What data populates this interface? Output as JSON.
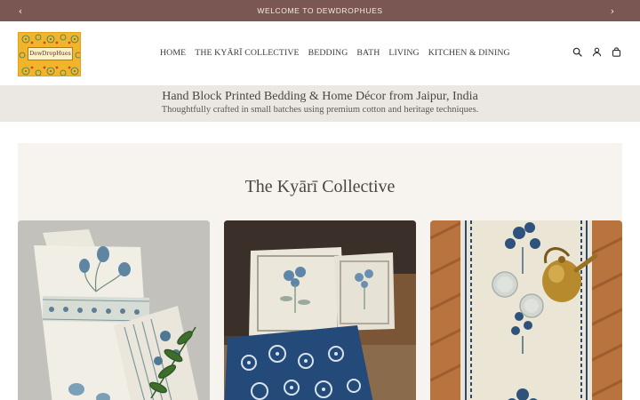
{
  "announcement": {
    "text": "WELCOME TO DEWDROPHUES",
    "prev_icon": "chevron-left-icon",
    "next_icon": "chevron-right-icon"
  },
  "header": {
    "logo_text": "DewDropHues",
    "nav": [
      {
        "label": "HOME"
      },
      {
        "label": "THE KYĀRĪ COLLECTIVE"
      },
      {
        "label": "BEDDING"
      },
      {
        "label": "BATH"
      },
      {
        "label": "LIVING"
      },
      {
        "label": "KITCHEN & DINING"
      }
    ],
    "icons": [
      "search-icon",
      "account-icon",
      "cart-icon"
    ]
  },
  "band": {
    "title": "Hand Block Printed Bedding & Home Décor from Jaipur, India",
    "subtitle": "Thoughtfully crafted in small batches using premium cotton and heritage techniques."
  },
  "collection": {
    "title": "The Kyārī Collective",
    "cards": [
      {
        "subject": "hand block printed tea towels with blue flowers"
      },
      {
        "subject": "block printed cushions with indigo throw"
      },
      {
        "subject": "block printed table runner with brass kettle"
      }
    ]
  },
  "colors": {
    "announcement_bg": "#7a5752",
    "band_bg": "#ebe8e3",
    "section_bg": "#f7f4ef",
    "logo_bg": "#f2b52a"
  }
}
